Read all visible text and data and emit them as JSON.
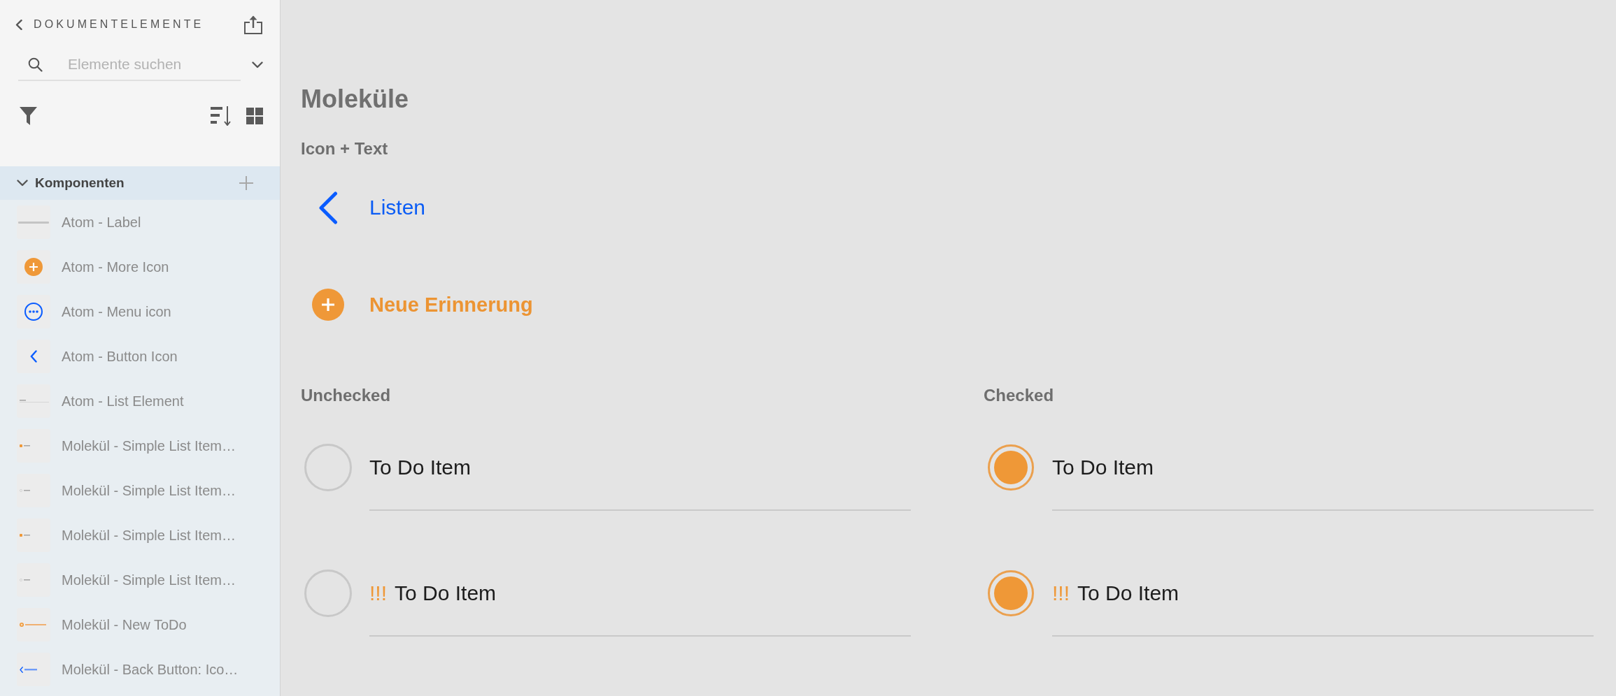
{
  "sidebar": {
    "header": {
      "title": "DOKUMENTELEMENTE"
    },
    "search": {
      "placeholder": "Elemente suchen"
    },
    "section": {
      "title": "Komponenten",
      "expanded": true,
      "items": [
        {
          "label": "Atom - Label",
          "thumbnail": {
            "kind": "label"
          }
        },
        {
          "label": "Atom - More Icon",
          "thumbnail": {
            "kind": "plus"
          }
        },
        {
          "label": "Atom - Menu icon",
          "thumbnail": {
            "kind": "menu"
          }
        },
        {
          "label": "Atom - Button Icon",
          "thumbnail": {
            "kind": "chevron"
          }
        },
        {
          "label": "Atom - List Element",
          "thumbnail": {
            "kind": "line"
          }
        },
        {
          "label": "Molekül - Simple List Item…",
          "thumbnail": {
            "kind": "todo",
            "checked": true
          }
        },
        {
          "label": "Molekül - Simple List Item…",
          "thumbnail": {
            "kind": "todo",
            "checked": false
          }
        },
        {
          "label": "Molekül - Simple List Item…",
          "thumbnail": {
            "kind": "todo",
            "checked": true
          }
        },
        {
          "label": "Molekül - Simple List Item…",
          "thumbnail": {
            "kind": "todo",
            "checked": false
          }
        },
        {
          "label": "Molekül - New ToDo",
          "thumbnail": {
            "kind": "new-todo"
          }
        },
        {
          "label": "Molekül - Back Button: Ico…",
          "thumbnail": {
            "kind": "back"
          }
        }
      ]
    }
  },
  "canvas": {
    "title": "Moleküle",
    "icon_text": {
      "heading": "Icon + Text",
      "items": [
        {
          "kind": "back",
          "label": "Listen"
        },
        {
          "kind": "add",
          "label": "Neue Erinnerung"
        }
      ]
    },
    "todo_groups": [
      {
        "heading": "Unchecked",
        "items": [
          {
            "text": "To Do Item",
            "checked": false
          },
          {
            "priority": "!!!",
            "text": "To Do Item",
            "checked": false
          }
        ]
      },
      {
        "heading": "Checked",
        "items": [
          {
            "text": "To Do Item",
            "checked": true
          },
          {
            "priority": "!!!",
            "text": "To Do Item",
            "checked": true
          }
        ]
      }
    ]
  }
}
